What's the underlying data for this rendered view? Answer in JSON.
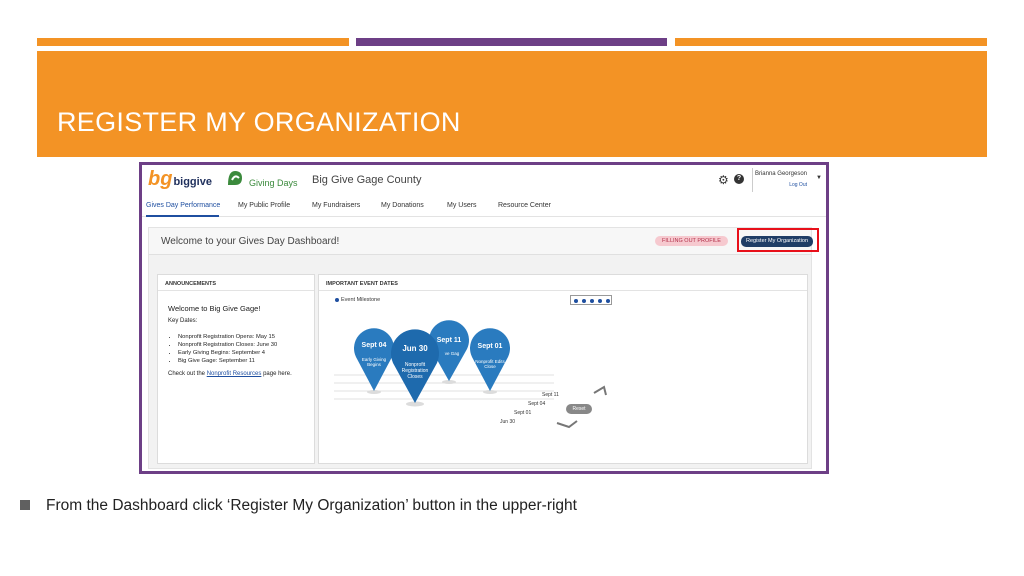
{
  "slide": {
    "title": "REGISTER MY ORGANIZATION",
    "bullet": "From the Dashboard click ‘Register My Organization’ button in the upper-right",
    "colors": {
      "orange": "#f39325",
      "purple": "#6d3f86",
      "highlight": "#e8101a"
    }
  },
  "app": {
    "logo": {
      "mark": "bg",
      "word": "biggive"
    },
    "giving_days_logo": "Giving Days",
    "county": "Big Give Gage County",
    "icons": [
      "gear-icon",
      "help-icon",
      "chevron-down-icon"
    ],
    "user": {
      "name": "Brianna Georgeson",
      "logout": "Log Out"
    },
    "nav": [
      {
        "label": "Gives Day Performance",
        "active": true
      },
      {
        "label": "My Public Profile"
      },
      {
        "label": "My Fundraisers"
      },
      {
        "label": "My Donations"
      },
      {
        "label": "My Users"
      },
      {
        "label": "Resource Center"
      }
    ],
    "welcome": "Welcome to your Gives Day Dashboard!",
    "status_pill": "FILLING OUT PROFILE",
    "register_button": "Register My Organization",
    "announcements": {
      "title": "ANNOUNCEMENTS",
      "heading": "Welcome to Big Give Gage!",
      "key_dates_label": "Key Dates:",
      "dates": [
        "Nonprofit Registration Opens: May 15",
        "Nonprofit Registration Closes: June 30",
        "Early Giving Begins: September 4",
        "Big Give Gage: September 11"
      ],
      "checkout_prefix": "Check out the ",
      "checkout_link": "Nonprofit Resources",
      "checkout_suffix": " page here."
    },
    "events": {
      "title": "IMPORTANT EVENT DATES",
      "legend": "Event Milestone",
      "pins": [
        {
          "date": "Sept 04",
          "label1": "Early Giving",
          "label2": "Begins",
          "label3": ""
        },
        {
          "date": "Sept 11",
          "label1": "ve Gag",
          "label2": "",
          "label3": ""
        },
        {
          "date": "Jun 30",
          "label1": "Nonprofit",
          "label2": "Registration",
          "label3": "Closes"
        },
        {
          "date": "Sept 01",
          "label1": "Nonprofit Edits",
          "label2": "Close",
          "label3": ""
        }
      ],
      "axis_labels": [
        "Sept 11",
        "Sept 04",
        "Sept 01",
        "Jun 30"
      ],
      "reset": "Reset"
    }
  }
}
